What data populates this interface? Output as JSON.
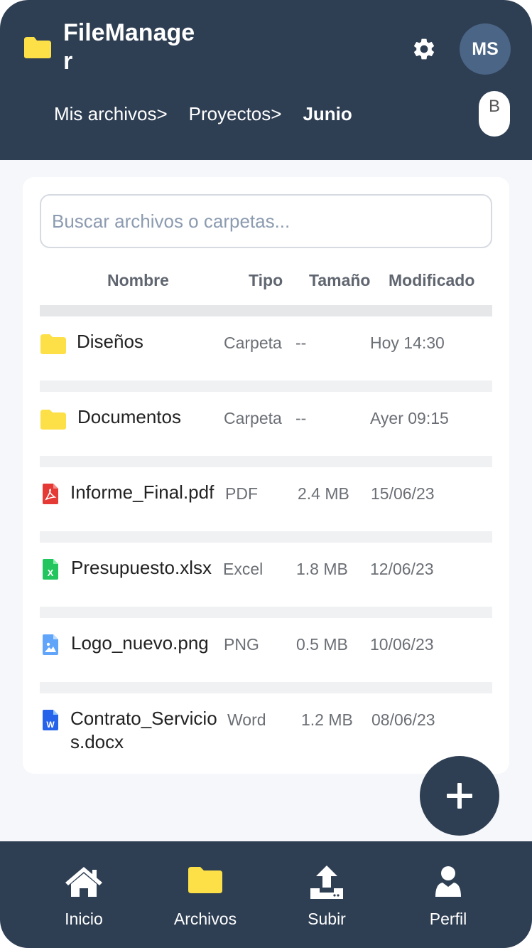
{
  "header": {
    "app_title": "FileManager",
    "avatar_initials": "MS",
    "pill_text": "B",
    "breadcrumb": [
      "Mis archivos>",
      "Proyectos>",
      "Junio"
    ]
  },
  "search": {
    "placeholder": "Buscar archivos o carpetas..."
  },
  "table": {
    "columns": [
      "Nombre",
      "Tipo",
      "Tamaño",
      "Modificado"
    ],
    "rows": [
      {
        "icon": "folder-icon",
        "name": "Diseños",
        "type": "Carpeta",
        "size": "--",
        "modified": "Hoy 14:30"
      },
      {
        "icon": "folder-icon",
        "name": "Documentos",
        "type": "Carpeta",
        "size": "--",
        "modified": "Ayer 09:15"
      },
      {
        "icon": "pdf-file-icon",
        "name": "Informe_Final.pdf",
        "type": "PDF",
        "size": "2.4 MB",
        "modified": "15/06/23"
      },
      {
        "icon": "excel-file-icon",
        "name": "Presupuesto.xlsx",
        "type": "Excel",
        "size": "1.8 MB",
        "modified": "12/06/23"
      },
      {
        "icon": "image-file-icon",
        "name": "Logo_nuevo.png",
        "type": "PNG",
        "size": "0.5 MB",
        "modified": "10/06/23"
      },
      {
        "icon": "word-file-icon",
        "name": "Contrato_Servicios.docx",
        "type": "Word",
        "size": "1.2 MB",
        "modified": "08/06/23"
      }
    ]
  },
  "bottom_nav": [
    {
      "icon": "home-icon",
      "label": "Inicio"
    },
    {
      "icon": "folder-icon",
      "label": "Archivos"
    },
    {
      "icon": "upload-icon",
      "label": "Subir"
    },
    {
      "icon": "user-icon",
      "label": "Perfil"
    }
  ],
  "colors": {
    "header_bg": "#2e3e53",
    "avatar_bg": "#4a6585",
    "folder_yellow": "#fde047",
    "pdf_red": "#e53935",
    "excel_green": "#22c55e",
    "image_blue": "#60a5fa",
    "word_blue": "#2563eb"
  }
}
